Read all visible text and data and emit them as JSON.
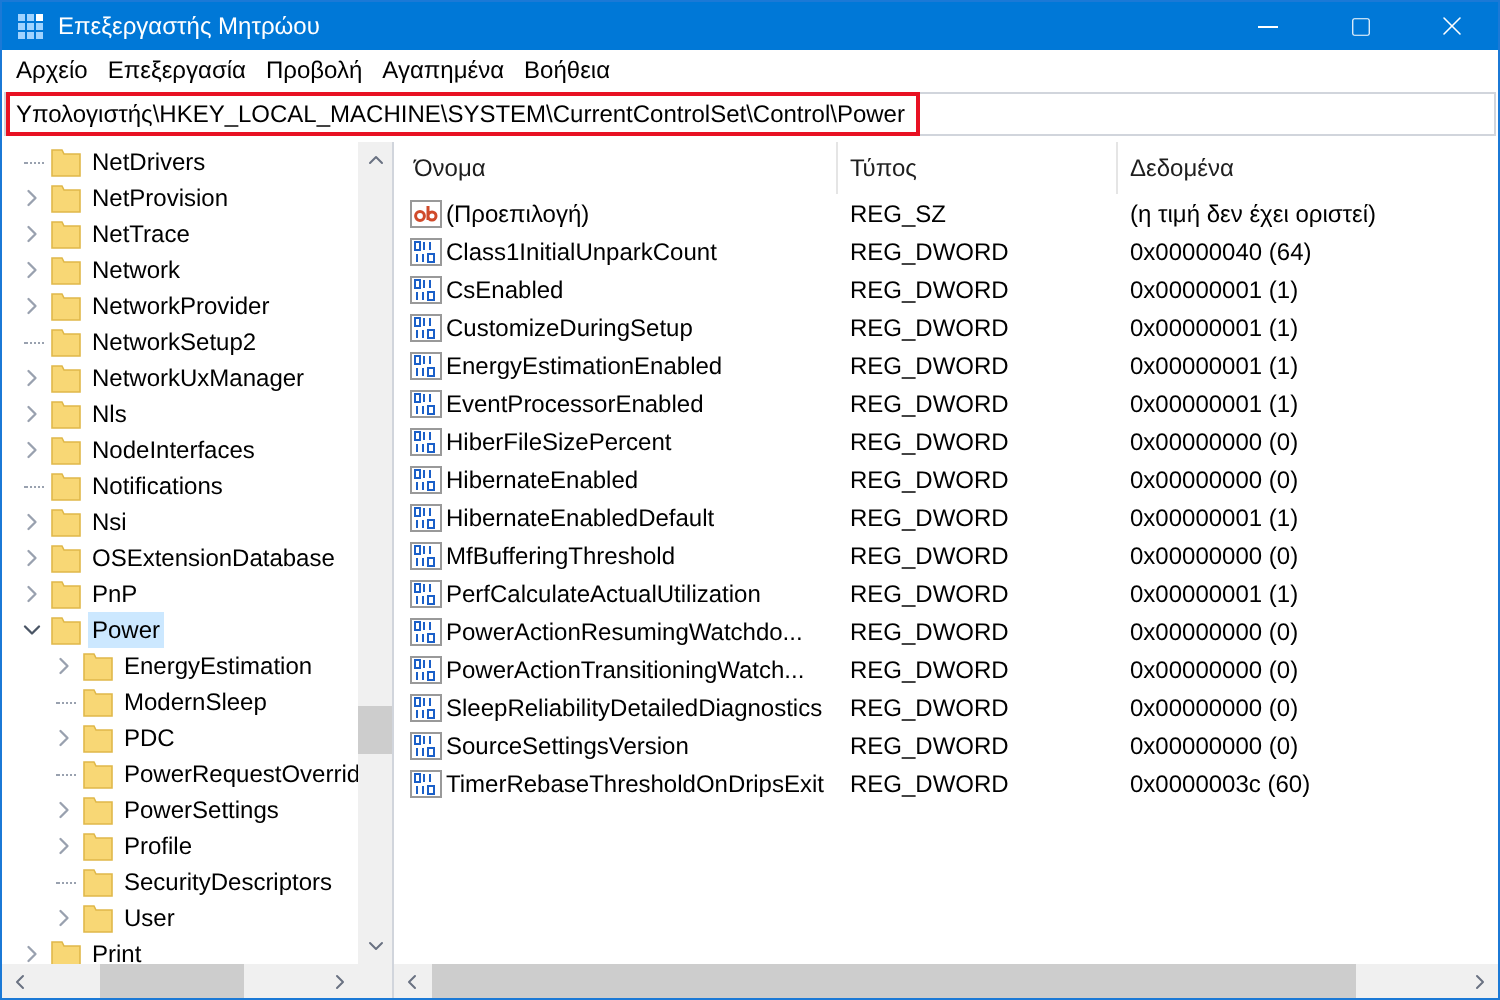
{
  "window": {
    "title": "Επεξεργαστής Μητρώου"
  },
  "menu": [
    "Αρχείο",
    "Επεξεργασία",
    "Προβολή",
    "Αγαπημένα",
    "Βοήθεια"
  ],
  "address": {
    "value": "Υπολογιστής\\HKEY_LOCAL_MACHINE\\SYSTEM\\CurrentControlSet\\Control\\Power",
    "highlighted": true
  },
  "tree": {
    "items": [
      {
        "label": "NetDrivers",
        "kind": "leaf",
        "selected": false
      },
      {
        "label": "NetProvision",
        "kind": "branch",
        "expanded": false,
        "selected": false
      },
      {
        "label": "NetTrace",
        "kind": "branch",
        "expanded": false,
        "selected": false
      },
      {
        "label": "Network",
        "kind": "branch",
        "expanded": false,
        "selected": false
      },
      {
        "label": "NetworkProvider",
        "kind": "branch",
        "expanded": false,
        "selected": false
      },
      {
        "label": "NetworkSetup2",
        "kind": "leaf",
        "selected": false
      },
      {
        "label": "NetworkUxManager",
        "kind": "branch",
        "expanded": false,
        "selected": false
      },
      {
        "label": "Nls",
        "kind": "branch",
        "expanded": false,
        "selected": false
      },
      {
        "label": "NodeInterfaces",
        "kind": "branch",
        "expanded": false,
        "selected": false
      },
      {
        "label": "Notifications",
        "kind": "leaf",
        "selected": false
      },
      {
        "label": "Nsi",
        "kind": "branch",
        "expanded": false,
        "selected": false
      },
      {
        "label": "OSExtensionDatabase",
        "kind": "branch",
        "expanded": false,
        "selected": false
      },
      {
        "label": "PnP",
        "kind": "branch",
        "expanded": false,
        "selected": false
      },
      {
        "label": "Power",
        "kind": "branch",
        "expanded": true,
        "selected": true,
        "children": [
          {
            "label": "EnergyEstimation",
            "kind": "branch",
            "expanded": false,
            "selected": false
          },
          {
            "label": "ModernSleep",
            "kind": "leaf",
            "selected": false
          },
          {
            "label": "PDC",
            "kind": "branch",
            "expanded": false,
            "selected": false
          },
          {
            "label": "PowerRequestOverrid",
            "kind": "leaf",
            "selected": false
          },
          {
            "label": "PowerSettings",
            "kind": "branch",
            "expanded": false,
            "selected": false
          },
          {
            "label": "Profile",
            "kind": "branch",
            "expanded": false,
            "selected": false
          },
          {
            "label": "SecurityDescriptors",
            "kind": "leaf",
            "selected": false
          },
          {
            "label": "User",
            "kind": "branch",
            "expanded": false,
            "selected": false
          }
        ]
      },
      {
        "label": "Print",
        "kind": "branch",
        "expanded": false,
        "selected": false
      }
    ]
  },
  "table": {
    "columns": [
      "Όνομα",
      "Τύπος",
      "Δεδομένα"
    ],
    "rows": [
      {
        "kind": "string",
        "name": "(Προεπιλογή)",
        "type": "REG_SZ",
        "data": "(η τιμή δεν έχει οριστεί)"
      },
      {
        "kind": "binary",
        "name": "Class1InitialUnparkCount",
        "type": "REG_DWORD",
        "data": "0x00000040 (64)"
      },
      {
        "kind": "binary",
        "name": "CsEnabled",
        "type": "REG_DWORD",
        "data": "0x00000001 (1)"
      },
      {
        "kind": "binary",
        "name": "CustomizeDuringSetup",
        "type": "REG_DWORD",
        "data": "0x00000001 (1)"
      },
      {
        "kind": "binary",
        "name": "EnergyEstimationEnabled",
        "type": "REG_DWORD",
        "data": "0x00000001 (1)"
      },
      {
        "kind": "binary",
        "name": "EventProcessorEnabled",
        "type": "REG_DWORD",
        "data": "0x00000001 (1)"
      },
      {
        "kind": "binary",
        "name": "HiberFileSizePercent",
        "type": "REG_DWORD",
        "data": "0x00000000 (0)"
      },
      {
        "kind": "binary",
        "name": "HibernateEnabled",
        "type": "REG_DWORD",
        "data": "0x00000000 (0)"
      },
      {
        "kind": "binary",
        "name": "HibernateEnabledDefault",
        "type": "REG_DWORD",
        "data": "0x00000001 (1)"
      },
      {
        "kind": "binary",
        "name": "MfBufferingThreshold",
        "type": "REG_DWORD",
        "data": "0x00000000 (0)"
      },
      {
        "kind": "binary",
        "name": "PerfCalculateActualUtilization",
        "type": "REG_DWORD",
        "data": "0x00000001 (1)"
      },
      {
        "kind": "binary",
        "name": "PowerActionResumingWatchdo...",
        "type": "REG_DWORD",
        "data": "0x00000000 (0)"
      },
      {
        "kind": "binary",
        "name": "PowerActionTransitioningWatch...",
        "type": "REG_DWORD",
        "data": "0x00000000 (0)"
      },
      {
        "kind": "binary",
        "name": "SleepReliabilityDetailedDiagnostics",
        "type": "REG_DWORD",
        "data": "0x00000000 (0)"
      },
      {
        "kind": "binary",
        "name": "SourceSettingsVersion",
        "type": "REG_DWORD",
        "data": "0x00000000 (0)"
      },
      {
        "kind": "binary",
        "name": "TimerRebaseThresholdOnDripsExit",
        "type": "REG_DWORD",
        "data": "0x0000003c (60)"
      }
    ]
  }
}
